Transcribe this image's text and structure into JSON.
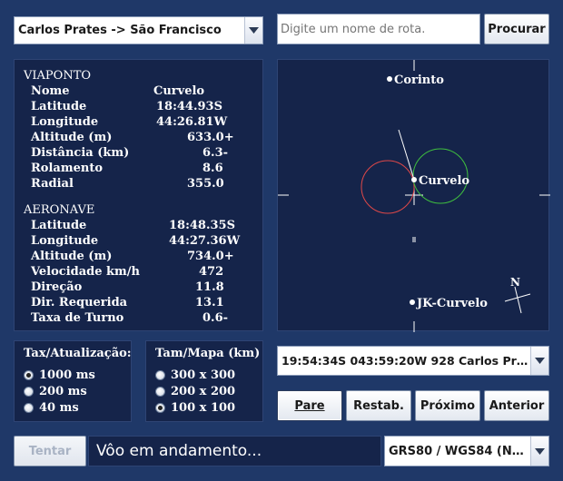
{
  "route_select": {
    "value": "Carlos Prates -> São Francisco"
  },
  "search": {
    "placeholder": "Digite um nome de rota.",
    "button": "Procurar"
  },
  "waypoint": {
    "header": "VIAPONTO",
    "rows": [
      {
        "label": "Nome",
        "value": "Curvelo"
      },
      {
        "label": "Latitude",
        "value": "18:44.93S"
      },
      {
        "label": "Longitude",
        "value": "44:26.81W"
      },
      {
        "label": "Altitude (m)",
        "value": "633.0+"
      },
      {
        "label": "Distância (km)",
        "value": "6.3-"
      },
      {
        "label": "Rolamento",
        "value": "8.6"
      },
      {
        "label": "Radial",
        "value": "355.0"
      }
    ]
  },
  "aircraft": {
    "header": "AERONAVE",
    "rows": [
      {
        "label": "Latitude",
        "value": "18:48.35S"
      },
      {
        "label": "Longitude",
        "value": "44:27.36W"
      },
      {
        "label": "Altitude (m)",
        "value": "734.0+"
      },
      {
        "label": "Velocidade km/h",
        "value": "472"
      },
      {
        "label": "Direção",
        "value": "11.8"
      },
      {
        "label": "Dir. Requerida",
        "value": "13.1"
      },
      {
        "label": "Taxa de Turno",
        "value": "0.6-"
      }
    ]
  },
  "map": {
    "places": [
      {
        "name": "Corinto"
      },
      {
        "name": "Curvelo"
      },
      {
        "name": "JK-Curvelo"
      }
    ],
    "north_label": "N"
  },
  "update_rate": {
    "title": "Tax/Atualização:",
    "options": [
      {
        "label": "1000 ms",
        "selected": true
      },
      {
        "label": "200 ms",
        "selected": false
      },
      {
        "label": "40 ms",
        "selected": false
      }
    ]
  },
  "map_size": {
    "title": "Tam/Mapa (km)",
    "options": [
      {
        "label": "300 x 300",
        "selected": false
      },
      {
        "label": "200 x 200",
        "selected": false
      },
      {
        "label": "100 x 100",
        "selected": true
      }
    ]
  },
  "waypoint_select": {
    "value": "19:54:34S 043:59:20W   928 Carlos Pra..."
  },
  "controls": {
    "stop": "Pare",
    "reset": "Restab.",
    "next": "Próximo",
    "previous": "Anterior"
  },
  "footer": {
    "retry": "Tentar",
    "status": "Vôo em andamento...",
    "datum": "GRS80 / WGS84 (NA..."
  },
  "colors": {
    "background": "#1f3868",
    "panel": "#15244a",
    "circle_red": "#e04848",
    "circle_green": "#3fbf3f"
  }
}
